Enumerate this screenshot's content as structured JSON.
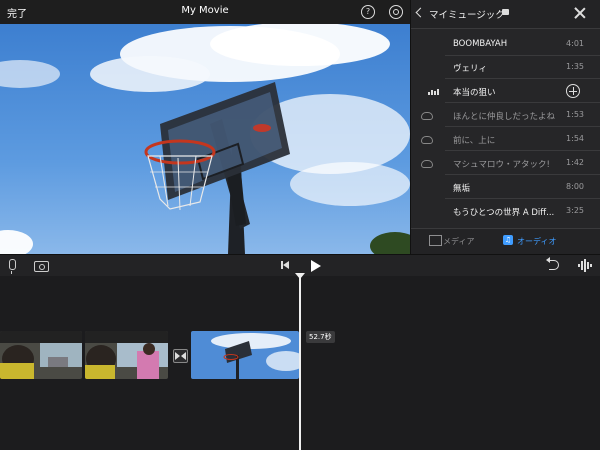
{
  "header": {
    "done_label": "完了",
    "title": "My Movie",
    "help_glyph": "?"
  },
  "music_panel": {
    "title": "マイミュージック",
    "songs": [
      {
        "title": "BOOMBAYAH",
        "duration": "4:01",
        "status": "available"
      },
      {
        "title": "ヴェリィ",
        "duration": "1:35",
        "status": "available"
      },
      {
        "title": "本当の狙い",
        "duration": "",
        "status": "playing"
      },
      {
        "title": "ほんとに仲良しだったよね",
        "duration": "1:53",
        "status": "cloud"
      },
      {
        "title": "前に、上に",
        "duration": "1:54",
        "status": "cloud"
      },
      {
        "title": "マシュマロウ・アタック!",
        "duration": "1:42",
        "status": "cloud"
      },
      {
        "title": "無垢",
        "duration": "8:00",
        "status": "available"
      },
      {
        "title": "もうひとつの世界 A Diff...",
        "duration": "3:25",
        "status": "available"
      }
    ],
    "tabs": {
      "media": "メディア",
      "audio": "オーディオ"
    }
  },
  "timeline": {
    "clip_duration": "52.7秒"
  },
  "colors": {
    "accent": "#3f9cff",
    "background": "#1c1c1e",
    "panel": "#262628"
  }
}
